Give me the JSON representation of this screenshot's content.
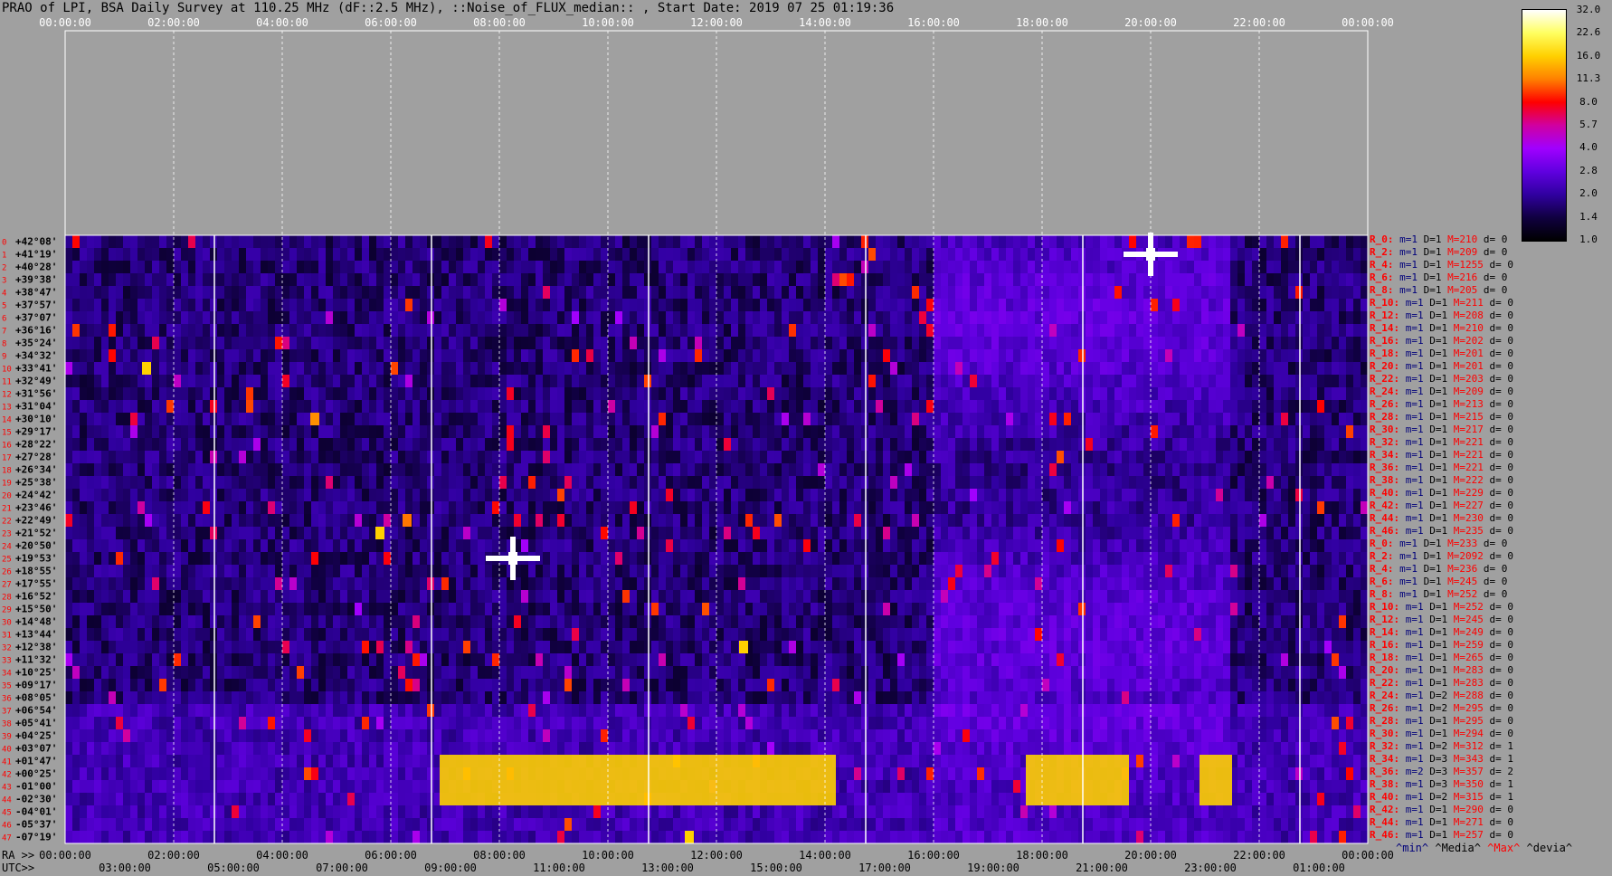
{
  "title": "PRAO of LPI, BSA Daily Survey at 110.25 MHz (dF::2.5 MHz), ::Noise_of_FLUX_median:: , Start Date: 2019 07 25 01:19:36",
  "chart_data": {
    "type": "heatmap",
    "title": "PRAO of LPI, BSA Daily Survey at 110.25 MHz (dF::2.5 MHz), ::Noise_of_FLUX_median:: , Start Date: 2019 07 25 01:19:36",
    "top_axis_ticks": [
      "00:00:00",
      "02:00:00",
      "04:00:00",
      "06:00:00",
      "08:00:00",
      "10:00:00",
      "12:00:00",
      "14:00:00",
      "16:00:00",
      "18:00:00",
      "20:00:00",
      "22:00:00",
      "00:00:00"
    ],
    "ra_axis_label": "RA >>",
    "ra_axis_ticks": [
      "00:00:00",
      "02:00:00",
      "04:00:00",
      "06:00:00",
      "08:00:00",
      "10:00:00",
      "12:00:00",
      "14:00:00",
      "16:00:00",
      "18:00:00",
      "20:00:00",
      "22:00:00",
      "00:00:00"
    ],
    "utc_axis_label": "UTC>>",
    "utc_axis_ticks": [
      "03:00:00",
      "05:00:00",
      "07:00:00",
      "09:00:00",
      "11:00:00",
      "13:00:00",
      "15:00:00",
      "17:00:00",
      "19:00:00",
      "21:00:00",
      "23:00:00",
      "01:00:00"
    ],
    "ra_range_hours": [
      0,
      24
    ],
    "declinations": [
      "+42°08'",
      "+41°19'",
      "+40°28'",
      "+39°38'",
      "+38°47'",
      "+37°57'",
      "+37°07'",
      "+36°16'",
      "+35°24'",
      "+34°32'",
      "+33°41'",
      "+32°49'",
      "+31°56'",
      "+31°04'",
      "+30°10'",
      "+29°17'",
      "+28°22'",
      "+27°28'",
      "+26°34'",
      "+25°38'",
      "+24°42'",
      "+23°46'",
      "+22°49'",
      "+21°52'",
      "+20°50'",
      "+19°53'",
      "+18°55'",
      "+17°55'",
      "+16°52'",
      "+15°50'",
      "+14°48'",
      "+13°44'",
      "+12°38'",
      "+11°32'",
      "+10°25'",
      "+09°17'",
      "+08°05'",
      "+06°54'",
      "+05°41'",
      "+04°25'",
      "+03°07'",
      "+01°47'",
      "+00°25'",
      "-01°00'",
      "-02°30'",
      "-04°01'",
      "-05°37'",
      "-07°19'"
    ],
    "beam_numbers": [
      "0",
      "1",
      "2",
      "3",
      "4",
      "5",
      "6",
      "7",
      "8",
      "9",
      "10",
      "11",
      "12",
      "13",
      "14",
      "15",
      "16",
      "17",
      "18",
      "19",
      "20",
      "21",
      "22",
      "23",
      "24",
      "25",
      "26",
      "27",
      "28",
      "29",
      "30",
      "31",
      "32",
      "33",
      "34",
      "35",
      "36",
      "37",
      "38",
      "39",
      "40",
      "41",
      "42",
      "43",
      "44",
      "45",
      "46",
      "47"
    ],
    "colorbar_ticks": [
      "32.0",
      "22.6",
      "16.0",
      "11.3",
      "8.0",
      "5.7",
      "4.0",
      "2.8",
      "2.0",
      "1.4",
      "1.0"
    ],
    "colorbar_range": [
      1.0,
      32.0
    ],
    "colorbar_scale": "log",
    "colormap": [
      "#ffffff",
      "#ffff60",
      "#ffd000",
      "#ff8000",
      "#ff0000",
      "#d000a0",
      "#a000ff",
      "#6000e0",
      "#3000a0",
      "#100040",
      "#000000"
    ],
    "bright_sources": [
      {
        "ra_hours": 8.25,
        "dec_row": 25,
        "intensity": 32
      },
      {
        "ra_hours": 20.0,
        "dec_row": 1,
        "intensity": 32
      },
      {
        "ra_hours": 5.8,
        "dec_row": 23,
        "intensity": 16
      },
      {
        "ra_hours": 12.5,
        "dec_row": 32,
        "intensity": 16
      },
      {
        "ra_hours": 1.5,
        "dec_row": 10,
        "intensity": 16
      },
      {
        "ra_hours": 4.6,
        "dec_row": 14,
        "intensity": 12
      },
      {
        "ra_hours": 6.3,
        "dec_row": 22,
        "intensity": 11
      },
      {
        "ra_hours": 11.5,
        "dec_row": 47,
        "intensity": 16
      }
    ],
    "interference_band": {
      "dec_rows": [
        41,
        44
      ],
      "ra_ranges": [
        [
          6.9,
          14.2
        ],
        [
          17.7,
          19.6
        ],
        [
          20.9,
          21.5
        ]
      ],
      "intensity": 16
    },
    "vertical_lines_ra_hours": [
      2.75,
      6.75,
      10.75,
      14.75,
      18.75,
      22.75
    ]
  },
  "right_panel": {
    "rows": [
      {
        "k": "R_0:",
        "m": "m=1",
        "d": "D=1",
        "M": "M=210",
        "z": "d= 0"
      },
      {
        "k": "R_2:",
        "m": "m=1",
        "d": "D=1",
        "M": "M=209",
        "z": "d= 0"
      },
      {
        "k": "R_4:",
        "m": "m=1",
        "d": "D=1",
        "M": "M=1255",
        "z": "d= 0"
      },
      {
        "k": "R_6:",
        "m": "m=1",
        "d": "D=1",
        "M": "M=216",
        "z": "d= 0"
      },
      {
        "k": "R_8:",
        "m": "m=1",
        "d": "D=1",
        "M": "M=205",
        "z": "d= 0"
      },
      {
        "k": "R_10:",
        "m": "m=1",
        "d": "D=1",
        "M": "M=211",
        "z": "d= 0"
      },
      {
        "k": "R_12:",
        "m": "m=1",
        "d": "D=1",
        "M": "M=208",
        "z": "d= 0"
      },
      {
        "k": "R_14:",
        "m": "m=1",
        "d": "D=1",
        "M": "M=210",
        "z": "d= 0"
      },
      {
        "k": "R_16:",
        "m": "m=1",
        "d": "D=1",
        "M": "M=202",
        "z": "d= 0"
      },
      {
        "k": "R_18:",
        "m": "m=1",
        "d": "D=1",
        "M": "M=201",
        "z": "d= 0"
      },
      {
        "k": "R_20:",
        "m": "m=1",
        "d": "D=1",
        "M": "M=201",
        "z": "d= 0"
      },
      {
        "k": "R_22:",
        "m": "m=1",
        "d": "D=1",
        "M": "M=203",
        "z": "d= 0"
      },
      {
        "k": "R_24:",
        "m": "m=1",
        "d": "D=1",
        "M": "M=209",
        "z": "d= 0"
      },
      {
        "k": "R_26:",
        "m": "m=1",
        "d": "D=1",
        "M": "M=213",
        "z": "d= 0"
      },
      {
        "k": "R_28:",
        "m": "m=1",
        "d": "D=1",
        "M": "M=215",
        "z": "d= 0"
      },
      {
        "k": "R_30:",
        "m": "m=1",
        "d": "D=1",
        "M": "M=217",
        "z": "d= 0"
      },
      {
        "k": "R_32:",
        "m": "m=1",
        "d": "D=1",
        "M": "M=221",
        "z": "d= 0"
      },
      {
        "k": "R_34:",
        "m": "m=1",
        "d": "D=1",
        "M": "M=221",
        "z": "d= 0"
      },
      {
        "k": "R_36:",
        "m": "m=1",
        "d": "D=1",
        "M": "M=221",
        "z": "d= 0"
      },
      {
        "k": "R_38:",
        "m": "m=1",
        "d": "D=1",
        "M": "M=222",
        "z": "d= 0"
      },
      {
        "k": "R_40:",
        "m": "m=1",
        "d": "D=1",
        "M": "M=229",
        "z": "d= 0"
      },
      {
        "k": "R_42:",
        "m": "m=1",
        "d": "D=1",
        "M": "M=227",
        "z": "d= 0"
      },
      {
        "k": "R_44:",
        "m": "m=1",
        "d": "D=1",
        "M": "M=230",
        "z": "d= 0"
      },
      {
        "k": "R_46:",
        "m": "m=1",
        "d": "D=1",
        "M": "M=235",
        "z": "d= 0"
      },
      {
        "k": "R_0:",
        "m": "m=1",
        "d": "D=1",
        "M": "M=233",
        "z": "d= 0"
      },
      {
        "k": "R_2:",
        "m": "m=1",
        "d": "D=1",
        "M": "M=2092",
        "z": "d= 0"
      },
      {
        "k": "R_4:",
        "m": "m=1",
        "d": "D=1",
        "M": "M=236",
        "z": "d= 0"
      },
      {
        "k": "R_6:",
        "m": "m=1",
        "d": "D=1",
        "M": "M=245",
        "z": "d= 0"
      },
      {
        "k": "R_8:",
        "m": "m=1",
        "d": "D=1",
        "M": "M=252",
        "z": "d= 0"
      },
      {
        "k": "R_10:",
        "m": "m=1",
        "d": "D=1",
        "M": "M=252",
        "z": "d= 0"
      },
      {
        "k": "R_12:",
        "m": "m=1",
        "d": "D=1",
        "M": "M=245",
        "z": "d= 0"
      },
      {
        "k": "R_14:",
        "m": "m=1",
        "d": "D=1",
        "M": "M=249",
        "z": "d= 0"
      },
      {
        "k": "R_16:",
        "m": "m=1",
        "d": "D=1",
        "M": "M=259",
        "z": "d= 0"
      },
      {
        "k": "R_18:",
        "m": "m=1",
        "d": "D=1",
        "M": "M=265",
        "z": "d= 0"
      },
      {
        "k": "R_20:",
        "m": "m=1",
        "d": "D=1",
        "M": "M=283",
        "z": "d= 0"
      },
      {
        "k": "R_22:",
        "m": "m=1",
        "d": "D=1",
        "M": "M=283",
        "z": "d= 0"
      },
      {
        "k": "R_24:",
        "m": "m=1",
        "d": "D=2",
        "M": "M=288",
        "z": "d= 0"
      },
      {
        "k": "R_26:",
        "m": "m=1",
        "d": "D=2",
        "M": "M=295",
        "z": "d= 0"
      },
      {
        "k": "R_28:",
        "m": "m=1",
        "d": "D=1",
        "M": "M=295",
        "z": "d= 0"
      },
      {
        "k": "R_30:",
        "m": "m=1",
        "d": "D=1",
        "M": "M=294",
        "z": "d= 0"
      },
      {
        "k": "R_32:",
        "m": "m=1",
        "d": "D=2",
        "M": "M=312",
        "z": "d= 1"
      },
      {
        "k": "R_34:",
        "m": "m=1",
        "d": "D=3",
        "M": "M=343",
        "z": "d= 1"
      },
      {
        "k": "R_36:",
        "m": "m=2",
        "d": "D=3",
        "M": "M=357",
        "z": "d= 2"
      },
      {
        "k": "R_38:",
        "m": "m=1",
        "d": "D=3",
        "M": "M=350",
        "z": "d= 1"
      },
      {
        "k": "R_40:",
        "m": "m=1",
        "d": "D=2",
        "M": "M=315",
        "z": "d= 1"
      },
      {
        "k": "R_42:",
        "m": "m=1",
        "d": "D=1",
        "M": "M=290",
        "z": "d= 0"
      },
      {
        "k": "R_44:",
        "m": "m=1",
        "d": "D=1",
        "M": "M=271",
        "z": "d= 0"
      },
      {
        "k": "R_46:",
        "m": "m=1",
        "d": "D=1",
        "M": "M=257",
        "z": "d= 0"
      }
    ]
  },
  "legend": {
    "min": "^min^",
    "median": "^Media^",
    "max": "^Max^",
    "dev": "^devia^"
  }
}
